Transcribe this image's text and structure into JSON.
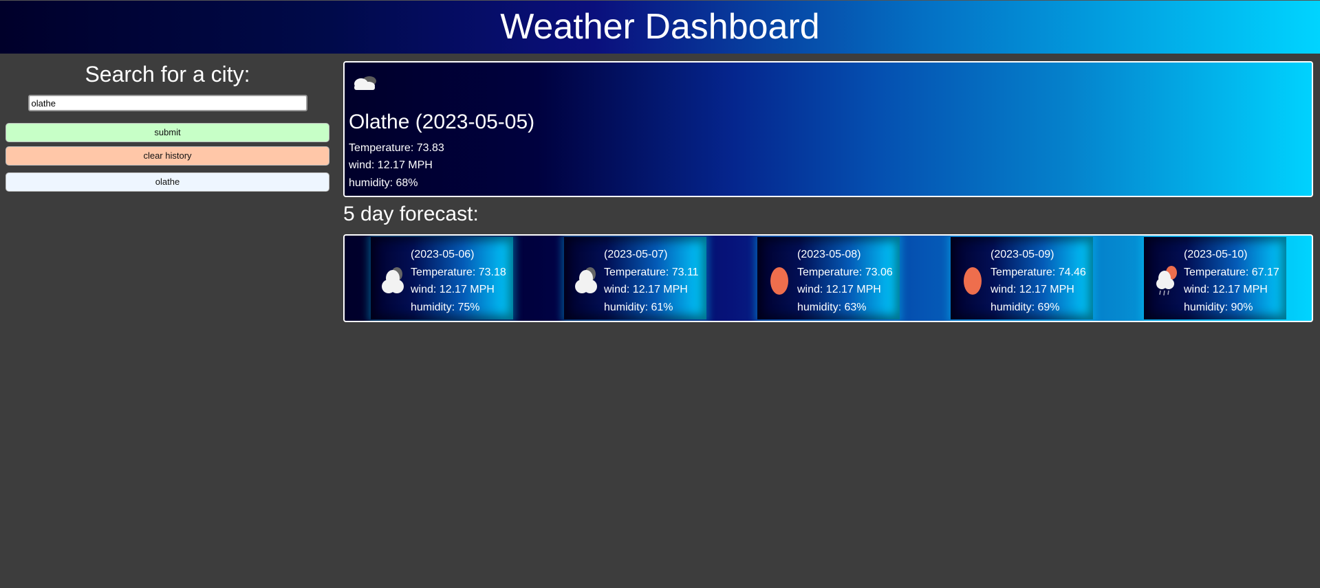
{
  "header": {
    "title": "Weather Dashboard"
  },
  "sidebar": {
    "search_title": "Search for a city:",
    "search_value": "olathe",
    "submit_label": "submit",
    "clear_label": "clear history",
    "history": [
      "olathe"
    ]
  },
  "current": {
    "icon": "cloud-night-icon",
    "city_date": "Olathe (2023-05-05)",
    "temperature": "Temperature: 73.83",
    "wind": "wind: 12.17 MPH",
    "humidity": "humidity: 68%"
  },
  "forecast": {
    "title": "5 day forecast:",
    "days": [
      {
        "date": "(2023-05-06)",
        "temperature": "Temperature: 73.18",
        "wind": "wind: 12.17 MPH",
        "humidity": "humidity: 75%",
        "icon": "cloud-icon"
      },
      {
        "date": "(2023-05-07)",
        "temperature": "Temperature: 73.11",
        "wind": "wind: 12.17 MPH",
        "humidity": "humidity: 61%",
        "icon": "cloud-icon"
      },
      {
        "date": "(2023-05-08)",
        "temperature": "Temperature: 73.06",
        "wind": "wind: 12.17 MPH",
        "humidity": "humidity: 63%",
        "icon": "sun-icon"
      },
      {
        "date": "(2023-05-09)",
        "temperature": "Temperature: 74.46",
        "wind": "wind: 12.17 MPH",
        "humidity": "humidity: 69%",
        "icon": "sun-icon"
      },
      {
        "date": "(2023-05-10)",
        "temperature": "Temperature: 67.17",
        "wind": "wind: 12.17 MPH",
        "humidity": "humidity: 90%",
        "icon": "sun-rain-cloud-icon"
      }
    ]
  },
  "colors": {
    "page_bg": "#3d3d3d",
    "submit_bg": "#c7ffc7",
    "clear_bg": "#ffc7a8",
    "history_bg": "#eef6ff",
    "sun": "#ee6e4d"
  }
}
